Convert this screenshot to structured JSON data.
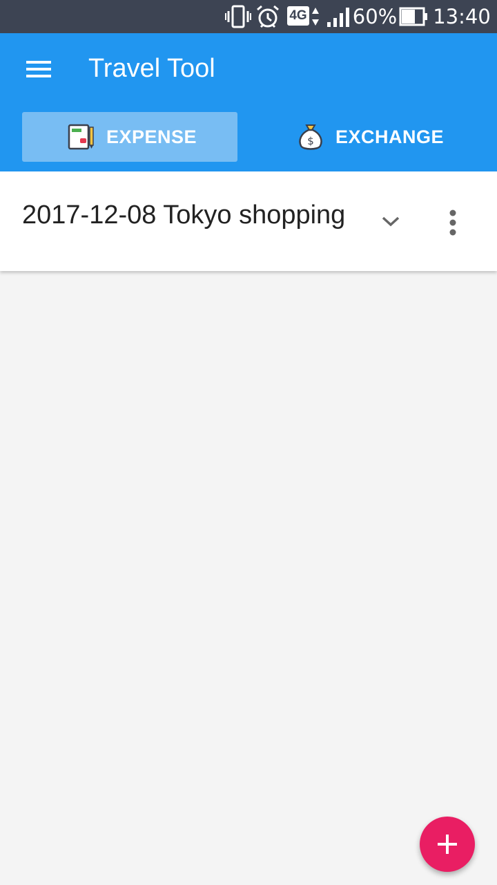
{
  "status_bar": {
    "battery_percent": "60%",
    "time": "13:40",
    "network_label": "4G",
    "icons": [
      "vibrate-icon",
      "alarm-icon",
      "network-4g-icon",
      "signal-icon",
      "battery-icon"
    ]
  },
  "app_bar": {
    "title": "Travel Tool",
    "menu_icon": "hamburger-menu-icon",
    "color": "#2196f0"
  },
  "tabs": [
    {
      "label": "EXPENSE",
      "icon": "notebook-pencil-icon",
      "active": true
    },
    {
      "label": "EXCHANGE",
      "icon": "money-bag-icon",
      "active": false
    }
  ],
  "trip_selector": {
    "selected": "2017-12-08 Tokyo shopping",
    "dropdown_icon": "chevron-down-icon",
    "more_icon": "more-vert-icon"
  },
  "fab": {
    "icon": "plus-icon",
    "color": "#e91e63"
  }
}
